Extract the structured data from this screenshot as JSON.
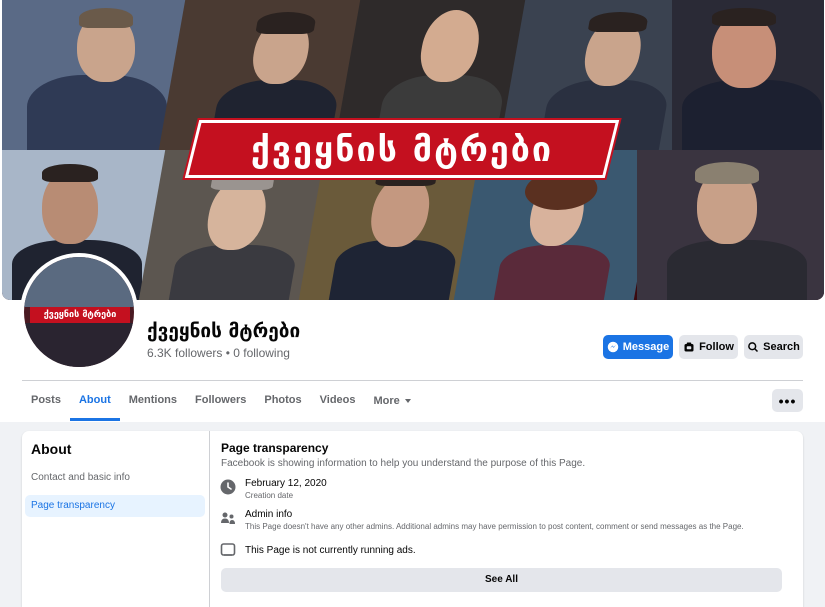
{
  "cover": {
    "banner_text": "ქვეყნის მტრები"
  },
  "profile": {
    "avatar_banner_text": "ქვეყნის მტრები",
    "name": "ქვეყნის მტრები",
    "stats": "6.3K followers • 0 following"
  },
  "actions": {
    "message_label": "Message",
    "follow_label": "Follow",
    "search_label": "Search",
    "more_dots": "•••"
  },
  "tabs": [
    {
      "label": "Posts"
    },
    {
      "label": "About"
    },
    {
      "label": "Mentions"
    },
    {
      "label": "Followers"
    },
    {
      "label": "Photos"
    },
    {
      "label": "Videos"
    },
    {
      "label": "More"
    }
  ],
  "sidebar": {
    "title": "About",
    "items": [
      {
        "label": "Contact and basic info"
      },
      {
        "label": "Page transparency"
      }
    ]
  },
  "transparency": {
    "title": "Page transparency",
    "description": "Facebook is showing information to help you understand the purpose of this Page.",
    "creation_date": "February 12, 2020",
    "creation_label": "Creation date",
    "admin_title": "Admin info",
    "admin_desc": "This Page doesn't have any other admins. Additional admins may have permission to post content, comment or send messages as the Page.",
    "ads_text": "This Page is not currently running ads.",
    "see_all": "See All"
  },
  "colors": {
    "accent": "#1b74e4",
    "banner_red": "#c4101f",
    "cover_dark": "#3a0a10"
  }
}
